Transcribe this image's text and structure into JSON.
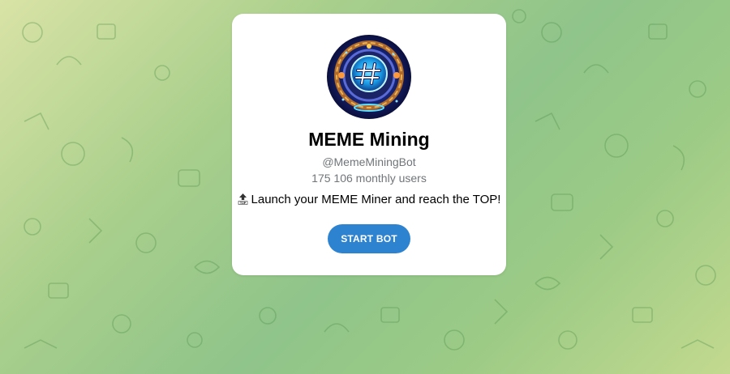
{
  "bot": {
    "name": "MEME Mining",
    "username": "@MemeMiningBot",
    "monthly_users": "175 106 monthly users",
    "description": "Launch your MEME Miner and reach the TOP!",
    "description_icon": "top-arrow-emoji"
  },
  "actions": {
    "start_label": "START BOT"
  },
  "colors": {
    "button": "#2d83d0",
    "secondary_text": "#707579"
  }
}
